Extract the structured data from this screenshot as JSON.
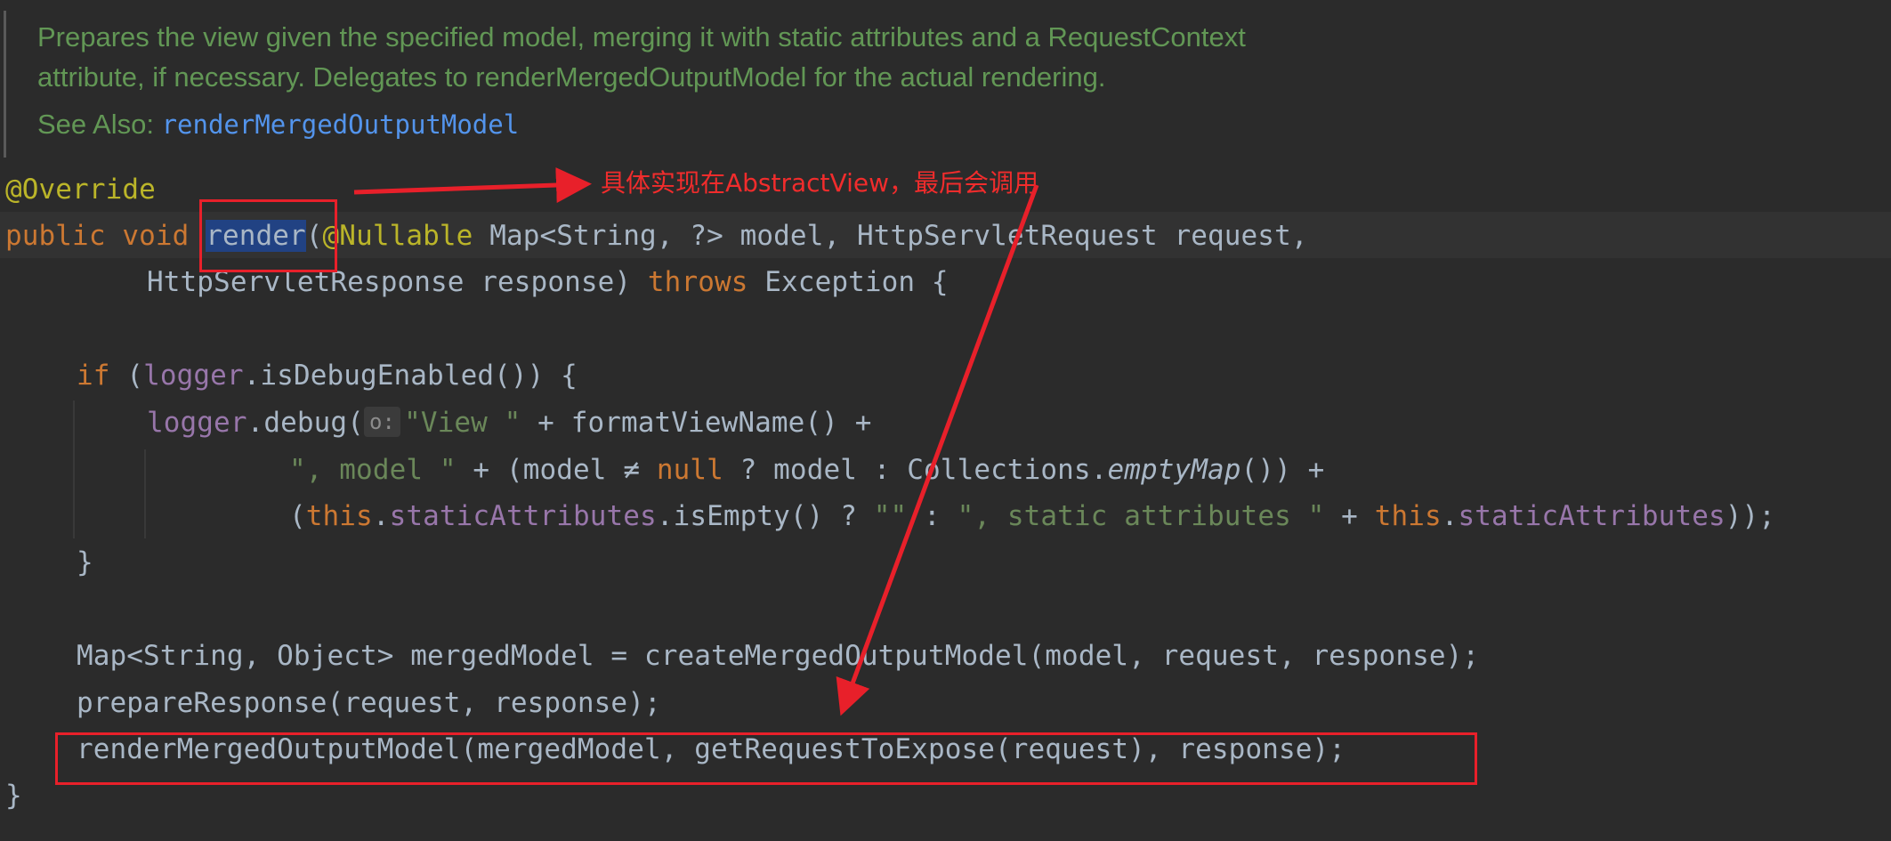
{
  "doc": {
    "line1": "Prepares the view given the specified model, merging it with static attributes and a RequestContext",
    "line2": "attribute, if necessary. Delegates to renderMergedOutputModel for the actual rendering.",
    "see_also_label": "See Also: ",
    "see_also_link": "renderMergedOutputModel"
  },
  "code": {
    "l1": {
      "ann": "@Override"
    },
    "l2": {
      "kw1": "public",
      "kw2": "void",
      "method": "render",
      "paren": "(",
      "ann": "@Nullable",
      "rest": "Map<String, ?> model, HttpServletRequest request,"
    },
    "l3": {
      "a": "HttpServletResponse response) ",
      "kw": "throws",
      "b": " Exception {"
    },
    "l4": {
      "kw": "if",
      "a": " (",
      "fld": "logger",
      "b": ".isDebugEnabled()) {"
    },
    "l5": {
      "fld": "logger",
      "a": ".debug(",
      "hint": "o:",
      "str": "\"View \"",
      "b": " + formatViewName() +"
    },
    "l6": {
      "str": "\", model \"",
      "a": " + (model ≠ ",
      "kw": "null",
      "b": " ? model : Collections.",
      "it": "emptyMap",
      "c": "()) +"
    },
    "l7": {
      "a": "(",
      "kw1": "this",
      "b": ".",
      "fld1": "staticAttributes",
      "c": ".isEmpty() ? ",
      "str1": "\"\"",
      "d": " : ",
      "str2": "\", static attributes \"",
      "e": " + ",
      "kw2": "this",
      "f": ".",
      "fld2": "staticAttributes",
      "g": "));"
    },
    "l8": {
      "a": "}"
    },
    "l9": {
      "a": "Map<String, Object> mergedModel = createMergedOutputModel(model, request, response);"
    },
    "l10": {
      "a": "prepareResponse(request, response);"
    },
    "l11": {
      "a": "renderMergedOutputModel(mergedModel, getRequestToExpose(request), response);"
    },
    "l12": {
      "a": "}"
    }
  },
  "annotation": {
    "text": "具体实现在AbstractView，最后会调用"
  },
  "colors": {
    "background": "#2b2b2b",
    "keyword": "#cc7832",
    "annotation": "#bbb529",
    "field": "#9876aa",
    "string": "#6a8759",
    "doc": "#629755",
    "link": "#5394ec",
    "selection": "#214283",
    "markup_red": "#e8202a"
  }
}
